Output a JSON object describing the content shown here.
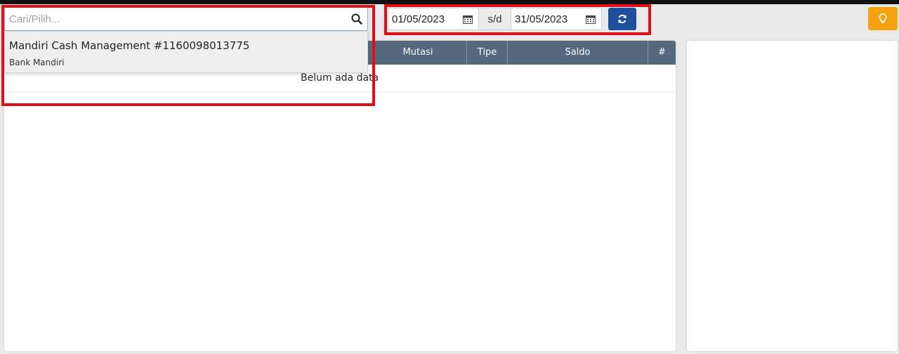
{
  "search": {
    "placeholder": "Cari/Pilih...",
    "value": ""
  },
  "dropdown": {
    "option_title": "Mandiri Cash Management #1160098013775",
    "option_subtitle": "Bank Mandiri"
  },
  "date_range": {
    "from": "01/05/2023",
    "separator": "s/d",
    "to": "31/05/2023"
  },
  "table": {
    "headers": [
      "Mutasi",
      "Tipe",
      "Saldo",
      "#"
    ],
    "empty_message": "Belum ada data"
  },
  "colors": {
    "header_bg": "#55687e",
    "refresh_button": "#1c4f9c",
    "tip_button": "#f4a20f",
    "highlight": "#e0101a"
  },
  "icons": {
    "search": "search-icon",
    "calendar": "calendar-icon",
    "refresh": "refresh-icon",
    "tip": "lightbulb-icon"
  }
}
